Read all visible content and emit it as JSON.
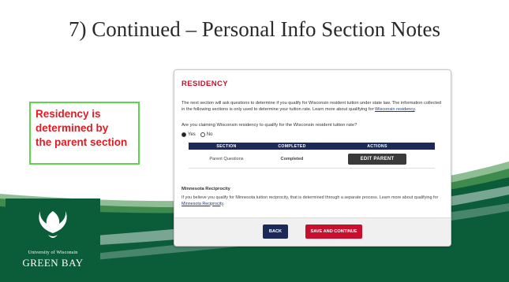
{
  "slide": {
    "title": "7) Continued – Personal Info Section Notes",
    "callout": {
      "line1": "Residency is",
      "line2": "determined by",
      "line3": "the parent section"
    },
    "logo": {
      "line1": "University of Wisconsin",
      "line2": "GREEN BAY"
    },
    "colors": {
      "callout_text": "#e31b23",
      "callout_border": "#59d64a",
      "footer_green": "#0b5d3a"
    }
  },
  "form": {
    "heading": "RESIDENCY",
    "intro_text": "The next section will ask questions to determine if you qualify for Wisconsin resident tuition under state law. The information collected in the following sections is only used to determine your tuition rate. Learn more about qualifying for",
    "intro_link": "Wisconsin residency",
    "intro_end": ".",
    "question": "Are you claiming Wisconsin residency to qualify for the Wisconsin resident tuition rate?",
    "options": [
      {
        "label": "Yes",
        "selected": true
      },
      {
        "label": "No",
        "selected": false
      }
    ],
    "table": {
      "headers": [
        "SECTION",
        "COMPLETED",
        "ACTIONS"
      ],
      "rows": [
        {
          "section": "Parent Questions",
          "completed": "Completed",
          "action": "EDIT PARENT"
        }
      ]
    },
    "reciprocity_heading": "Minnesota Reciprocity",
    "reciprocity_text": "If you believe you qualify for Minnesota tuition reciprocity, that is determined through a separate process. Learn more about qualifying for",
    "reciprocity_link": "Minnesota Reciprocity",
    "reciprocity_end": ".",
    "buttons": {
      "back": "BACK",
      "save": "SAVE AND CONTINUE"
    },
    "colors": {
      "heading": "#c8102e",
      "table_header": "#1c2a5a",
      "back_button": "#1c2a5a",
      "save_button": "#c8102e"
    }
  }
}
